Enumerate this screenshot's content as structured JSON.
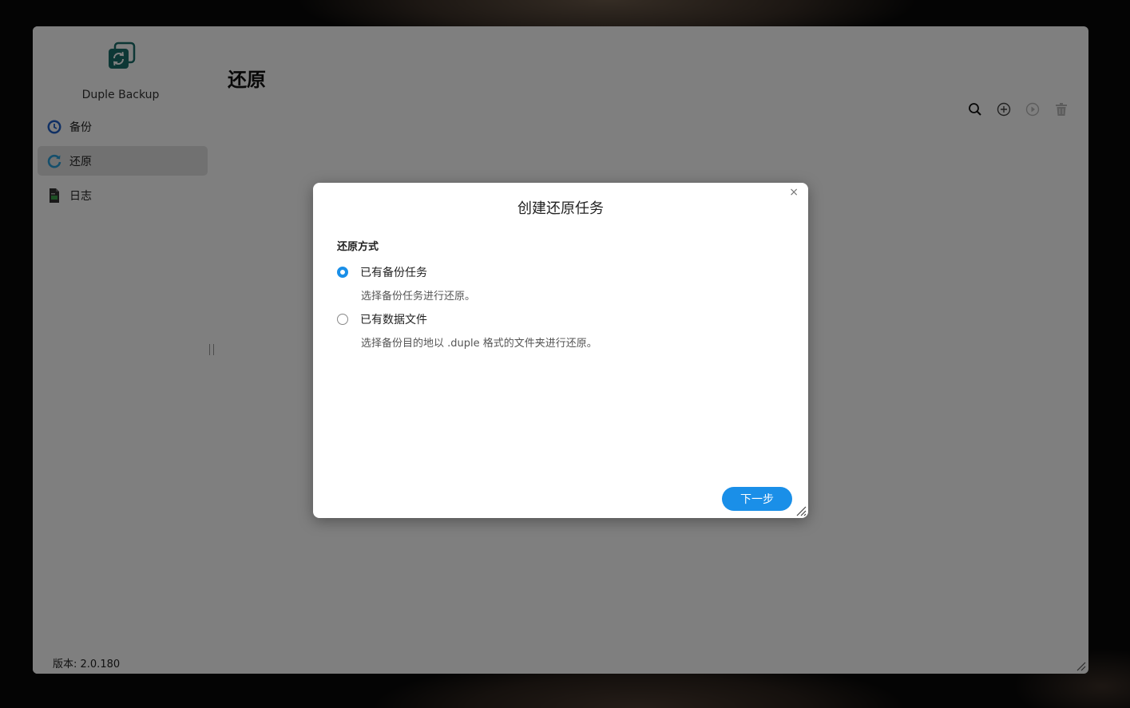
{
  "app": {
    "name": "Duple Backup",
    "version_label": "版本: 2.0.180"
  },
  "sidebar": {
    "items": [
      {
        "label": "备份",
        "icon": "clock-icon",
        "active": false
      },
      {
        "label": "还原",
        "icon": "restore-icon",
        "active": true
      },
      {
        "label": "日志",
        "icon": "log-icon",
        "active": false
      }
    ]
  },
  "main": {
    "title": "还原",
    "toolbar": [
      {
        "icon": "search-icon",
        "enabled": true
      },
      {
        "icon": "add-circle-icon",
        "enabled": true
      },
      {
        "icon": "play-circle-icon",
        "enabled": false
      },
      {
        "icon": "trash-icon",
        "enabled": false
      }
    ]
  },
  "dialog": {
    "title": "创建还原任务",
    "close_glyph": "×",
    "section_label": "还原方式",
    "options": [
      {
        "label": "已有备份任务",
        "description": "选择备份任务进行还原。",
        "checked": true
      },
      {
        "label": "已有数据文件",
        "description": "选择备份目的地以 .duple 格式的文件夹进行还原。",
        "checked": false
      }
    ],
    "next_label": "下一步"
  },
  "colors": {
    "accent": "#1a8fe8",
    "logo": "#1a6f6a",
    "overlay": "rgba(0,0,0,0.5)"
  }
}
